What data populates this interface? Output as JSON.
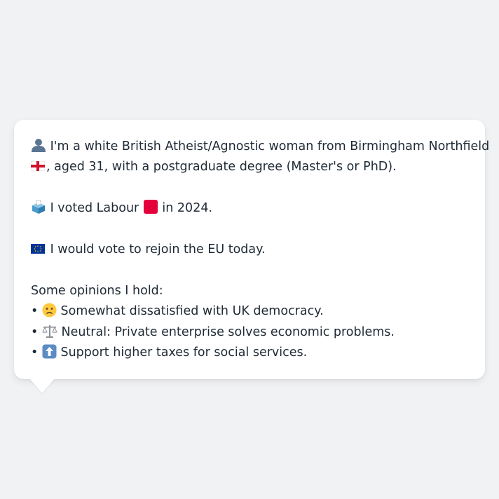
{
  "profile": {
    "intro_icon": "bust-in-silhouette-icon",
    "intro_line1": "I'm a white British Atheist/Agnostic woman from Birmingham Northfield",
    "intro_flag_icon": "england-flag-icon",
    "intro_line2": ", aged 31, with a postgraduate degree (Master's or PhD).",
    "vote_icon": "ballot-box-icon",
    "vote_prefix": "I voted Labour",
    "labour_color": "#e4003b",
    "vote_suffix": "in 2024.",
    "eu_icon": "eu-flag-icon",
    "eu_text": "I would vote to rejoin the EU today.",
    "opinions_heading": "Some opinions I hold:",
    "opinions": [
      {
        "bullet": "•",
        "icon": "slightly-frowning-face-icon",
        "glyph": "🙁",
        "text": "Somewhat dissatisfied with UK democracy."
      },
      {
        "bullet": "•",
        "icon": "balance-scale-icon",
        "glyph": "⚖️",
        "text": "Neutral: Private enterprise solves economic problems."
      },
      {
        "bullet": "•",
        "icon": "up-arrow-icon",
        "glyph": "⬆️",
        "text": "Support higher taxes for social services."
      }
    ]
  }
}
